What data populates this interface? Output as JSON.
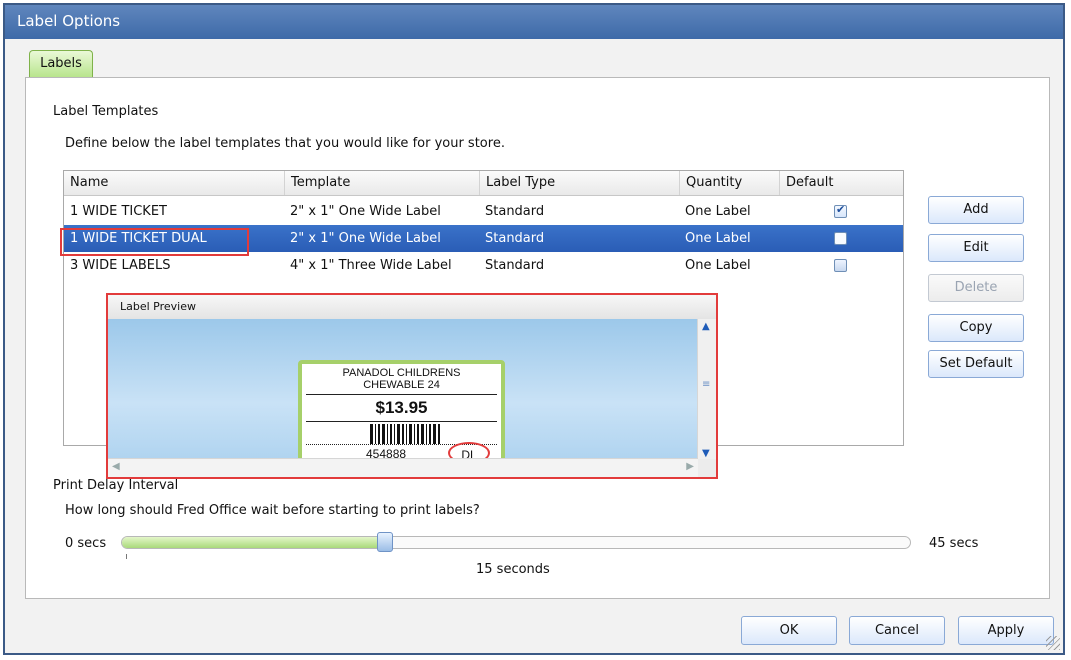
{
  "window": {
    "title": "Label Options"
  },
  "tabs": [
    {
      "label": "Labels"
    }
  ],
  "templates": {
    "section_title": "Label Templates",
    "description": "Define below the label templates that you would like for your store.",
    "columns": [
      "Name",
      "Template",
      "Label Type",
      "Quantity",
      "Default"
    ],
    "rows": [
      {
        "name": "1 WIDE TICKET",
        "template": "2\" x 1\" One Wide Label",
        "label_type": "Standard",
        "quantity": "One Label",
        "default": true,
        "selected": false
      },
      {
        "name": "1 WIDE TICKET DUAL",
        "template": "2\" x 1\" One Wide Label",
        "label_type": "Standard",
        "quantity": "One Label",
        "default": false,
        "selected": true
      },
      {
        "name": "3 WIDE LABELS",
        "template": "4\" x 1\" Three Wide Label",
        "label_type": "Standard",
        "quantity": "One Label",
        "default": false,
        "selected": false
      }
    ]
  },
  "preview": {
    "title": "Label Preview",
    "product_line1": "PANADOL CHILDRENS",
    "product_line2": "CHEWABLE 24",
    "price": "$13.95",
    "code": "454888",
    "badge": "DL"
  },
  "buttons": {
    "add": "Add",
    "edit": "Edit",
    "delete": "Delete",
    "copy": "Copy",
    "set_default": "Set Default"
  },
  "delay": {
    "title": "Print Delay Interval",
    "question": "How long should Fred Office wait before starting to print labels?",
    "min_label": "0 secs",
    "max_label": "45 secs",
    "min": 0,
    "max": 45,
    "value": 15,
    "value_label": "15 seconds"
  },
  "footer": {
    "ok": "OK",
    "cancel": "Cancel",
    "apply": "Apply"
  },
  "colors": {
    "accent": "#3a72c9",
    "highlight": "#e23b3b",
    "tab": "#b6e48a",
    "slider_fill": "#a9d97a"
  }
}
